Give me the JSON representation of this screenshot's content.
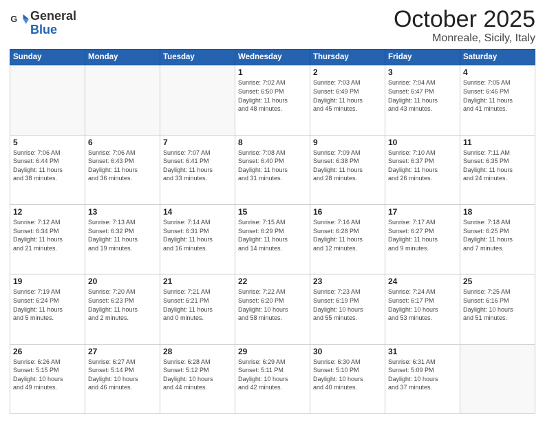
{
  "logo": {
    "line1": "General",
    "line2": "Blue"
  },
  "title": "October 2025",
  "subtitle": "Monreale, Sicily, Italy",
  "weekdays": [
    "Sunday",
    "Monday",
    "Tuesday",
    "Wednesday",
    "Thursday",
    "Friday",
    "Saturday"
  ],
  "weeks": [
    [
      {
        "day": "",
        "info": ""
      },
      {
        "day": "",
        "info": ""
      },
      {
        "day": "",
        "info": ""
      },
      {
        "day": "1",
        "info": "Sunrise: 7:02 AM\nSunset: 6:50 PM\nDaylight: 11 hours\nand 48 minutes."
      },
      {
        "day": "2",
        "info": "Sunrise: 7:03 AM\nSunset: 6:49 PM\nDaylight: 11 hours\nand 45 minutes."
      },
      {
        "day": "3",
        "info": "Sunrise: 7:04 AM\nSunset: 6:47 PM\nDaylight: 11 hours\nand 43 minutes."
      },
      {
        "day": "4",
        "info": "Sunrise: 7:05 AM\nSunset: 6:46 PM\nDaylight: 11 hours\nand 41 minutes."
      }
    ],
    [
      {
        "day": "5",
        "info": "Sunrise: 7:06 AM\nSunset: 6:44 PM\nDaylight: 11 hours\nand 38 minutes."
      },
      {
        "day": "6",
        "info": "Sunrise: 7:06 AM\nSunset: 6:43 PM\nDaylight: 11 hours\nand 36 minutes."
      },
      {
        "day": "7",
        "info": "Sunrise: 7:07 AM\nSunset: 6:41 PM\nDaylight: 11 hours\nand 33 minutes."
      },
      {
        "day": "8",
        "info": "Sunrise: 7:08 AM\nSunset: 6:40 PM\nDaylight: 11 hours\nand 31 minutes."
      },
      {
        "day": "9",
        "info": "Sunrise: 7:09 AM\nSunset: 6:38 PM\nDaylight: 11 hours\nand 28 minutes."
      },
      {
        "day": "10",
        "info": "Sunrise: 7:10 AM\nSunset: 6:37 PM\nDaylight: 11 hours\nand 26 minutes."
      },
      {
        "day": "11",
        "info": "Sunrise: 7:11 AM\nSunset: 6:35 PM\nDaylight: 11 hours\nand 24 minutes."
      }
    ],
    [
      {
        "day": "12",
        "info": "Sunrise: 7:12 AM\nSunset: 6:34 PM\nDaylight: 11 hours\nand 21 minutes."
      },
      {
        "day": "13",
        "info": "Sunrise: 7:13 AM\nSunset: 6:32 PM\nDaylight: 11 hours\nand 19 minutes."
      },
      {
        "day": "14",
        "info": "Sunrise: 7:14 AM\nSunset: 6:31 PM\nDaylight: 11 hours\nand 16 minutes."
      },
      {
        "day": "15",
        "info": "Sunrise: 7:15 AM\nSunset: 6:29 PM\nDaylight: 11 hours\nand 14 minutes."
      },
      {
        "day": "16",
        "info": "Sunrise: 7:16 AM\nSunset: 6:28 PM\nDaylight: 11 hours\nand 12 minutes."
      },
      {
        "day": "17",
        "info": "Sunrise: 7:17 AM\nSunset: 6:27 PM\nDaylight: 11 hours\nand 9 minutes."
      },
      {
        "day": "18",
        "info": "Sunrise: 7:18 AM\nSunset: 6:25 PM\nDaylight: 11 hours\nand 7 minutes."
      }
    ],
    [
      {
        "day": "19",
        "info": "Sunrise: 7:19 AM\nSunset: 6:24 PM\nDaylight: 11 hours\nand 5 minutes."
      },
      {
        "day": "20",
        "info": "Sunrise: 7:20 AM\nSunset: 6:23 PM\nDaylight: 11 hours\nand 2 minutes."
      },
      {
        "day": "21",
        "info": "Sunrise: 7:21 AM\nSunset: 6:21 PM\nDaylight: 11 hours\nand 0 minutes."
      },
      {
        "day": "22",
        "info": "Sunrise: 7:22 AM\nSunset: 6:20 PM\nDaylight: 10 hours\nand 58 minutes."
      },
      {
        "day": "23",
        "info": "Sunrise: 7:23 AM\nSunset: 6:19 PM\nDaylight: 10 hours\nand 55 minutes."
      },
      {
        "day": "24",
        "info": "Sunrise: 7:24 AM\nSunset: 6:17 PM\nDaylight: 10 hours\nand 53 minutes."
      },
      {
        "day": "25",
        "info": "Sunrise: 7:25 AM\nSunset: 6:16 PM\nDaylight: 10 hours\nand 51 minutes."
      }
    ],
    [
      {
        "day": "26",
        "info": "Sunrise: 6:26 AM\nSunset: 5:15 PM\nDaylight: 10 hours\nand 49 minutes."
      },
      {
        "day": "27",
        "info": "Sunrise: 6:27 AM\nSunset: 5:14 PM\nDaylight: 10 hours\nand 46 minutes."
      },
      {
        "day": "28",
        "info": "Sunrise: 6:28 AM\nSunset: 5:12 PM\nDaylight: 10 hours\nand 44 minutes."
      },
      {
        "day": "29",
        "info": "Sunrise: 6:29 AM\nSunset: 5:11 PM\nDaylight: 10 hours\nand 42 minutes."
      },
      {
        "day": "30",
        "info": "Sunrise: 6:30 AM\nSunset: 5:10 PM\nDaylight: 10 hours\nand 40 minutes."
      },
      {
        "day": "31",
        "info": "Sunrise: 6:31 AM\nSunset: 5:09 PM\nDaylight: 10 hours\nand 37 minutes."
      },
      {
        "day": "",
        "info": ""
      }
    ]
  ]
}
